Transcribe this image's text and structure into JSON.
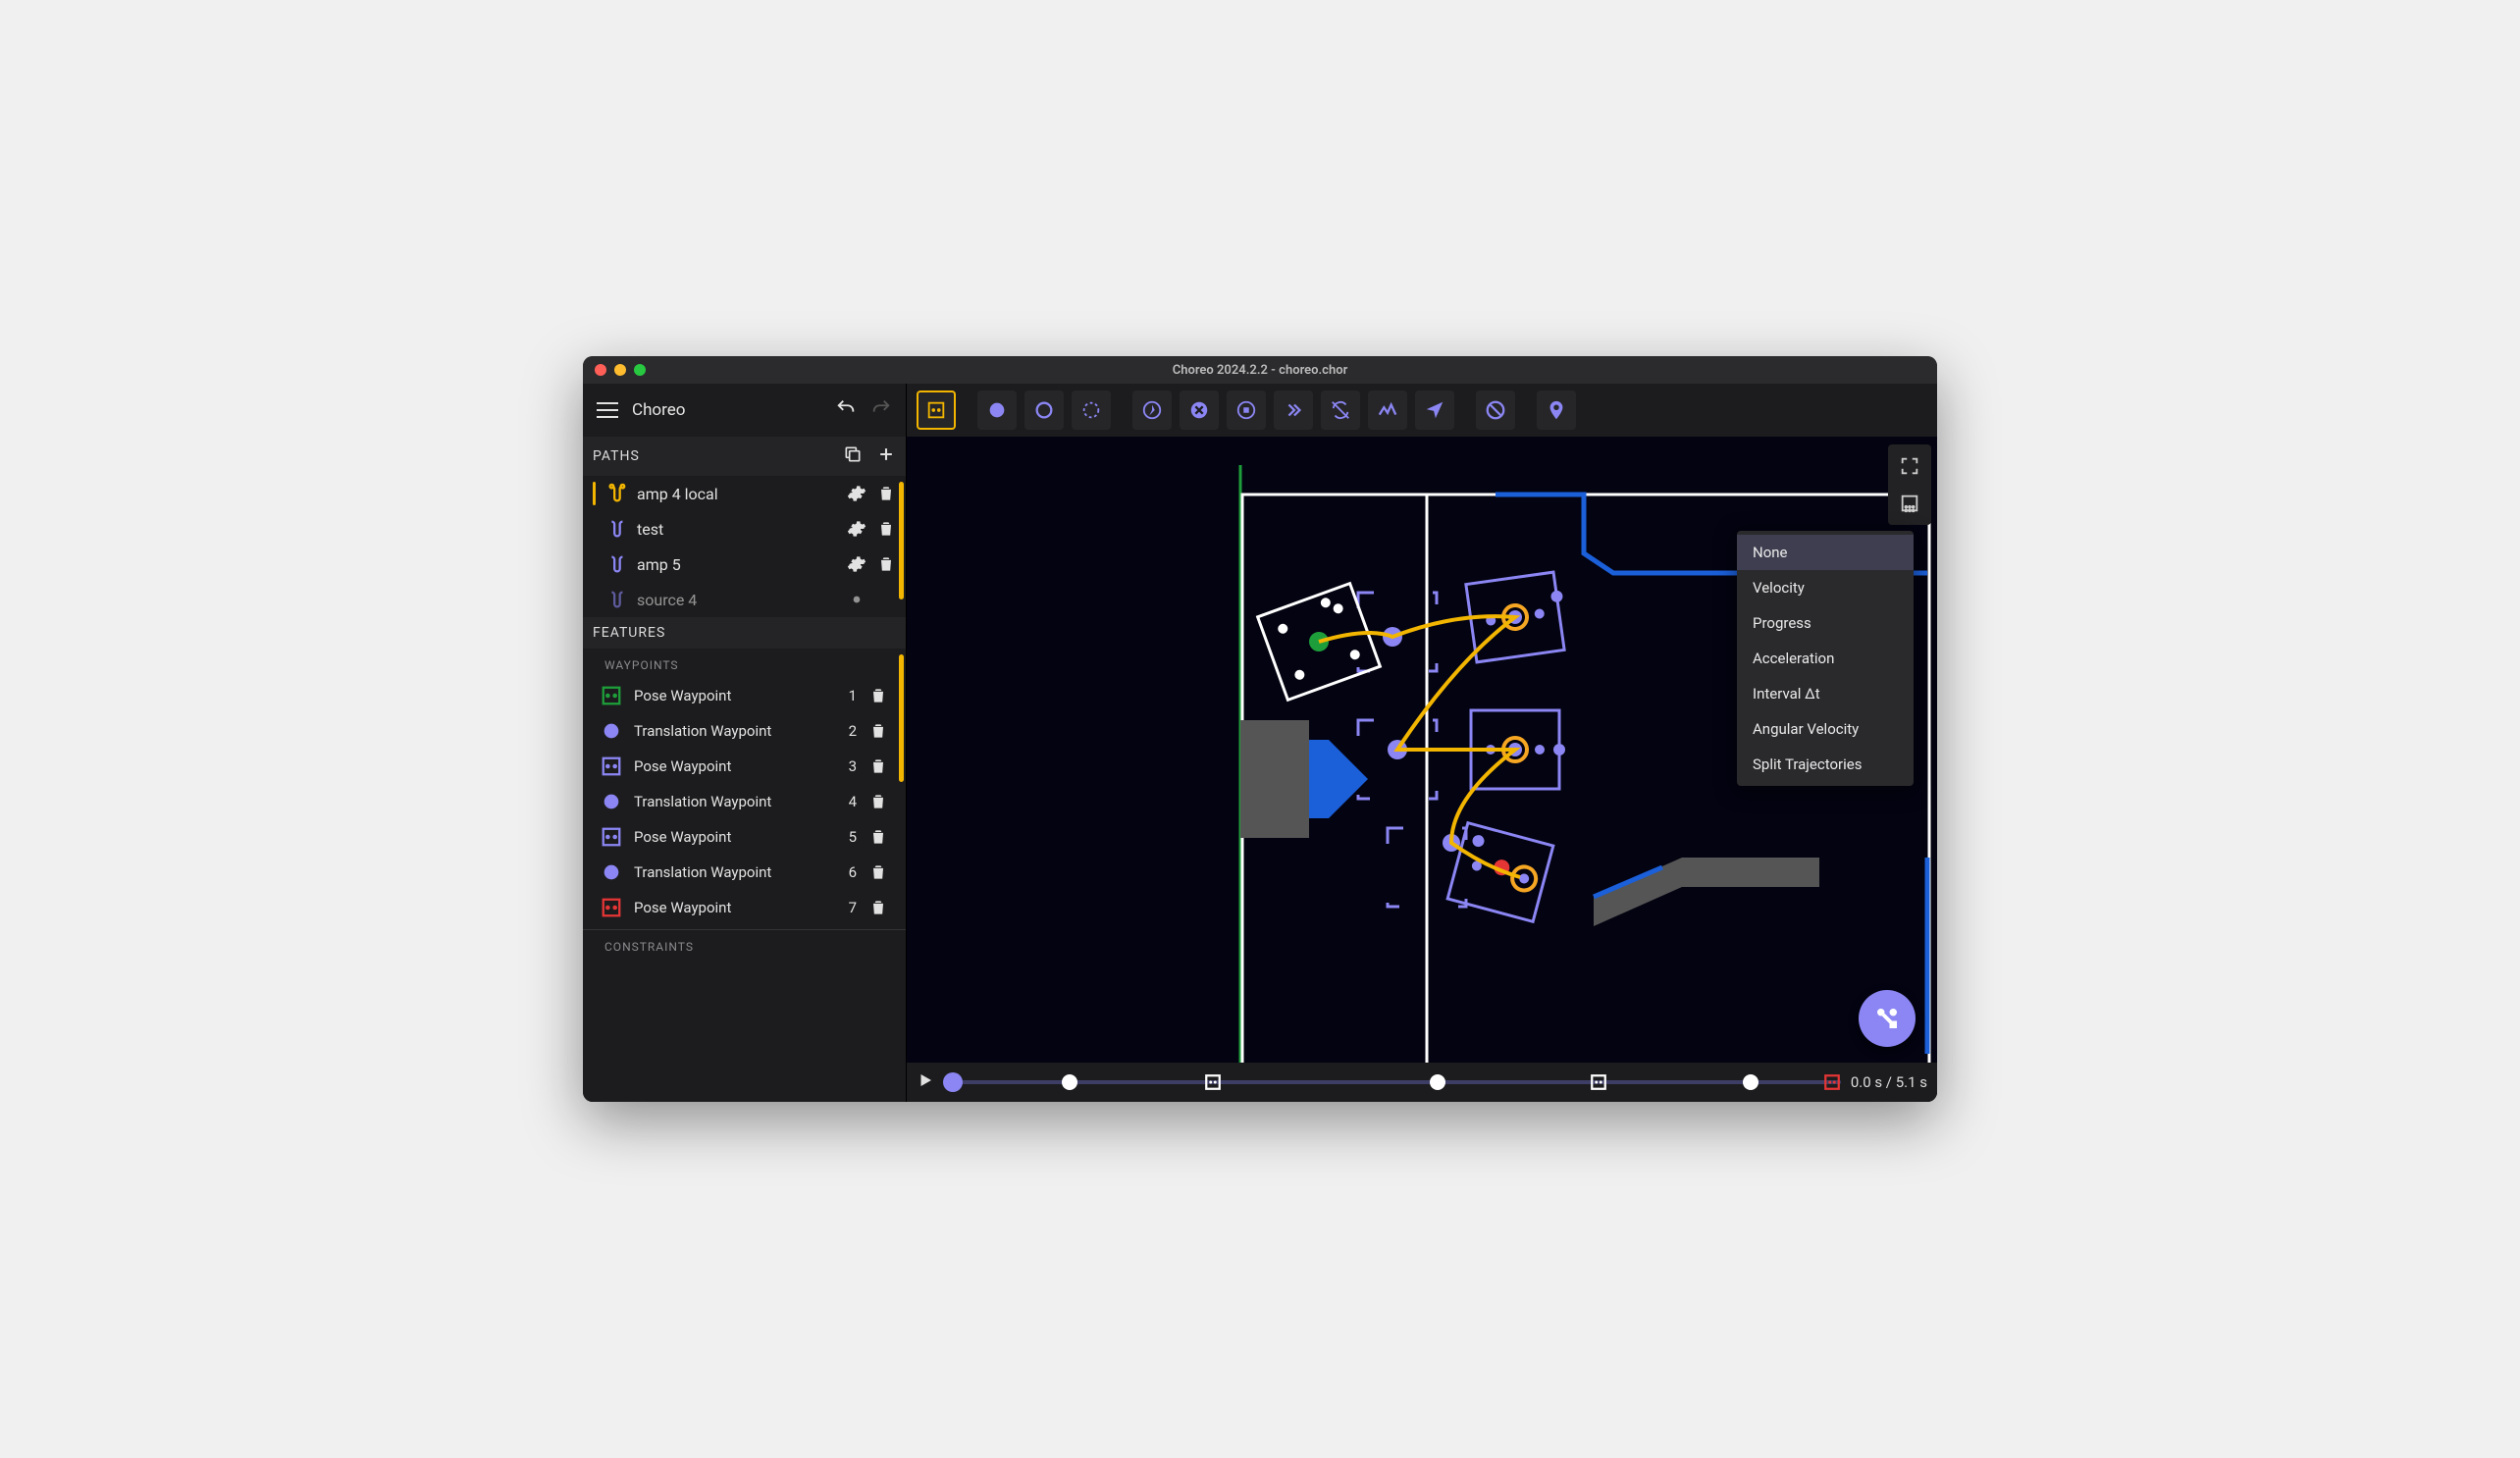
{
  "window": {
    "title": "Choreo 2024.2.2 - choreo.chor"
  },
  "app": {
    "name": "Choreo"
  },
  "sidebar": {
    "paths_header": "PATHS",
    "features_header": "FEATURES",
    "waypoints_header": "WAYPOINTS",
    "constraints_header": "CONSTRAINTS",
    "paths": [
      {
        "name": "amp 4 local",
        "active": true
      },
      {
        "name": "test",
        "active": false
      },
      {
        "name": "amp 5",
        "active": false
      },
      {
        "name": "source 4",
        "active": false
      }
    ],
    "waypoints": [
      {
        "label": "Pose Waypoint",
        "index": "1",
        "type": "pose-green"
      },
      {
        "label": "Translation Waypoint",
        "index": "2",
        "type": "translation"
      },
      {
        "label": "Pose Waypoint",
        "index": "3",
        "type": "pose-purple"
      },
      {
        "label": "Translation Waypoint",
        "index": "4",
        "type": "translation"
      },
      {
        "label": "Pose Waypoint",
        "index": "5",
        "type": "pose-purple"
      },
      {
        "label": "Translation Waypoint",
        "index": "6",
        "type": "translation"
      },
      {
        "label": "Pose Waypoint",
        "index": "7",
        "type": "pose-red"
      }
    ]
  },
  "toolbar": {
    "tools": [
      {
        "name": "select-tool",
        "icon": "pose-select",
        "selected": true
      },
      {
        "name": "circle-fill-tool",
        "icon": "circle-fill"
      },
      {
        "name": "circle-outline-tool",
        "icon": "circle-outline"
      },
      {
        "name": "rotate-tool",
        "icon": "rotate"
      },
      {
        "name": "compass-tool",
        "icon": "compass",
        "gapBefore": true
      },
      {
        "name": "cancel-tool",
        "icon": "cancel"
      },
      {
        "name": "stop-tool",
        "icon": "stop-circle"
      },
      {
        "name": "skip-tool",
        "icon": "double-chevron"
      },
      {
        "name": "sync-off-tool",
        "icon": "sync-off"
      },
      {
        "name": "path-tool",
        "icon": "wiggle"
      },
      {
        "name": "navigate-tool",
        "icon": "navigate"
      },
      {
        "name": "block-tool",
        "icon": "no-entry",
        "gapBefore": true
      },
      {
        "name": "location-tool",
        "icon": "location",
        "gapBefore": true
      }
    ]
  },
  "overlay_menu": {
    "items": [
      {
        "label": "None",
        "selected": true
      },
      {
        "label": "Velocity"
      },
      {
        "label": "Progress"
      },
      {
        "label": "Acceleration"
      },
      {
        "label": "Interval Δt"
      },
      {
        "label": "Angular Velocity"
      },
      {
        "label": "Split Trajectories"
      }
    ]
  },
  "timeline": {
    "current": "0.0 s",
    "total": "5.1 s",
    "label": "0.0 s / 5.1 s"
  },
  "colors": {
    "accent_yellow": "#f2b500",
    "accent_purple": "#8b86f3",
    "green": "#1e9e3a",
    "red": "#e53535",
    "blue": "#1b5fd9"
  }
}
